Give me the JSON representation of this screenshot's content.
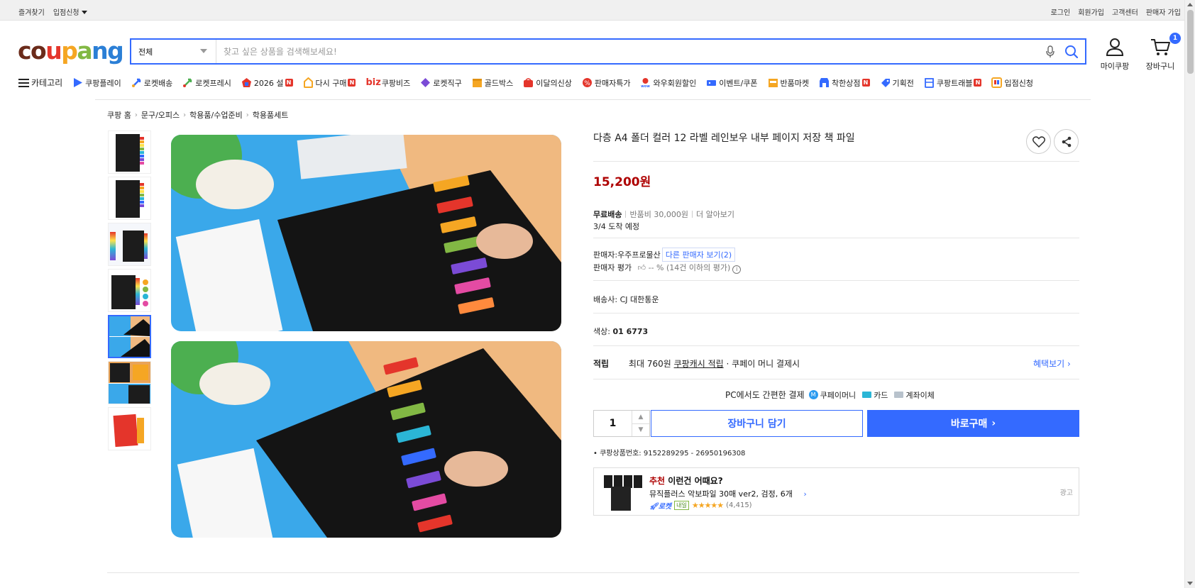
{
  "topbar": {
    "left": [
      "즐겨찾기",
      "입점신청"
    ],
    "right": [
      "로그인",
      "회원가입",
      "고객센터",
      "판매자 가입"
    ]
  },
  "header": {
    "logo": [
      "co",
      "u",
      "p",
      "a",
      "ng"
    ],
    "search_category": "전체",
    "search_placeholder": "찾고 싶은 상품을 검색해보세요!",
    "mycoupang": "마이쿠팡",
    "cart": "장바구니",
    "cart_count": "1"
  },
  "nav": {
    "category": "카테고리",
    "items": [
      {
        "label": "쿠팡플레이",
        "icon": "play-icon",
        "color": "#346aff"
      },
      {
        "label": "로켓배송",
        "icon": "rocket-icon",
        "color": "#346aff"
      },
      {
        "label": "로켓프레시",
        "icon": "rocket-fresh-icon",
        "color": "#4caf50"
      },
      {
        "label": "2026 설",
        "icon": "new-year-icon",
        "color": "#e4352b"
      },
      {
        "label": "다시 구매",
        "icon": "rebuy-icon",
        "color": "#f5a623"
      },
      {
        "label": "쿠팡비즈",
        "icon": "biz-icon",
        "color": "#e4352b"
      },
      {
        "label": "로켓직구",
        "icon": "rocket-global-icon",
        "color": "#7b4bd6"
      },
      {
        "label": "골드박스",
        "icon": "goldbox-icon",
        "color": "#f5a623"
      },
      {
        "label": "이달의신상",
        "icon": "new-arrival-icon",
        "color": "#e4352b"
      },
      {
        "label": "판매자특가",
        "icon": "seller-deal-icon",
        "color": "#e4352b"
      },
      {
        "label": "와우회원할인",
        "icon": "wow-icon",
        "color": "#e4352b"
      },
      {
        "label": "이벤트/쿠폰",
        "icon": "coupon-icon",
        "color": "#346aff"
      },
      {
        "label": "반품마켓",
        "icon": "return-market-icon",
        "color": "#f5a623"
      },
      {
        "label": "착한상점",
        "icon": "good-store-icon",
        "color": "#346aff"
      },
      {
        "label": "기획전",
        "icon": "promotion-icon",
        "color": "#346aff"
      },
      {
        "label": "쿠팡트래블",
        "icon": "travel-icon",
        "color": "#346aff"
      },
      {
        "label": "입점신청",
        "icon": "apply-icon",
        "color": "#f5a623"
      }
    ],
    "biz_prefix": "biz"
  },
  "breadcrumb": [
    "쿠팡 홈",
    "문구/오피스",
    "학용품/수업준비",
    "학용품세트"
  ],
  "product": {
    "title": "다층 A4 폴더 컬러 12 라벨 레인보우 내부 페이지 저장 책 파일",
    "price": "15,200원",
    "shipping_label": "무료배송",
    "return_fee": "반품비 30,000원",
    "more": "더 알아보기",
    "arrival": "3/4 도착 예정",
    "seller_prefix": "판매자:",
    "seller_name": "우주프로물산",
    "other_sellers": "다른 판매자 보기(2)",
    "seller_rating_label": "판매자 평가",
    "seller_rating": "-- % (14건 이하의 평가)",
    "carrier_label": "배송사:",
    "carrier": "CJ 대한통운",
    "color_label": "색상:",
    "color": "01 6773",
    "points_label": "적립",
    "points_text1": "최대 760원",
    "points_link": "쿠팡캐시 적립",
    "points_text2": "· 쿠페이 머니 결제시",
    "benefit": "혜택보기",
    "pay_title": "PC에서도 간편한 결제",
    "pay_money": "쿠페이머니",
    "pay_card": "카드",
    "pay_bank": "계좌이체",
    "quantity": "1",
    "cart_btn": "장바구니 담기",
    "buy_btn": "바로구매",
    "product_no": "쿠팡상품번호: 9152289295 - 26950196308"
  },
  "recommend": {
    "prefix": "추천",
    "title": "이런건 어때요?",
    "item": "뮤직플러스 악보파일 30매 ver2, 검정, 6개",
    "rocket": "로켓",
    "tomorrow": "내일",
    "reviews": "(4,415)",
    "rating": 5,
    "ad": "광고"
  },
  "colors": {
    "accent": "#346aff",
    "price": "#ae0000"
  }
}
